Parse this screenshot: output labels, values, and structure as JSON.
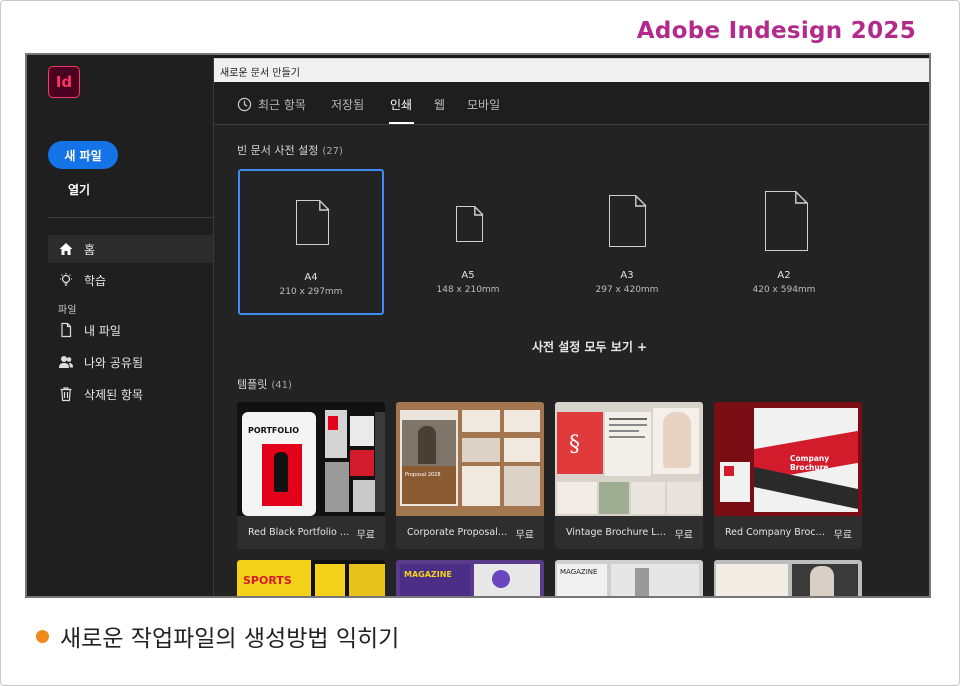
{
  "header": {
    "title": "Adobe Indesign 2025"
  },
  "app": {
    "logo_text": "Id"
  },
  "sidebar": {
    "new_file": "새 파일",
    "open": "열기",
    "items": [
      {
        "label": "홈",
        "icon": "home-icon"
      },
      {
        "label": "학습",
        "icon": "lightbulb-icon"
      }
    ],
    "section_files": "파일",
    "file_items": [
      {
        "label": "내 파일",
        "icon": "file-icon"
      },
      {
        "label": "나와 공유됨",
        "icon": "users-icon"
      },
      {
        "label": "삭제된 항목",
        "icon": "trash-icon"
      }
    ]
  },
  "dialog": {
    "title": "새로운 문서 만들기",
    "tabs": [
      {
        "label": "최근 항목",
        "icon": "clock-icon"
      },
      {
        "label": "저장됨"
      },
      {
        "label": "인쇄"
      },
      {
        "label": "웹"
      },
      {
        "label": "모바일"
      }
    ],
    "active_tab": "인쇄",
    "blank_presets_label": "빈 문서 사전 설정",
    "blank_presets_count": "(27)",
    "presets": [
      {
        "name": "A4",
        "size": "210 x 297mm"
      },
      {
        "name": "A5",
        "size": "148 x 210mm"
      },
      {
        "name": "A3",
        "size": "297 x 420mm"
      },
      {
        "name": "A2",
        "size": "420 x 594mm"
      }
    ],
    "view_all": "사전 설정 모두 보기 +",
    "templates_label": "템플릿",
    "templates_count": "(41)",
    "templates": [
      {
        "name": "Red Black Portfolio T...",
        "price": "무료"
      },
      {
        "name": "Corporate Proposal L...",
        "price": "무료"
      },
      {
        "name": "Vintage Brochure La...",
        "price": "무료"
      },
      {
        "name": "Red Company Broch...",
        "price": "무료"
      }
    ],
    "thumb_text": {
      "portfolio": "PORTFOLIO",
      "proposal": "Proposal 2028",
      "brochure": "Company Brochure",
      "sports": "SPORTS",
      "magazine1": "MAGAZINE",
      "magazine2": "MAGAZINE"
    }
  },
  "colors": {
    "accent": "#1473e6",
    "brand_title": "#b22a8b",
    "caption_dot": "#f08a1a"
  },
  "caption": {
    "text": "새로운 작업파일의 생성방법 익히기"
  }
}
